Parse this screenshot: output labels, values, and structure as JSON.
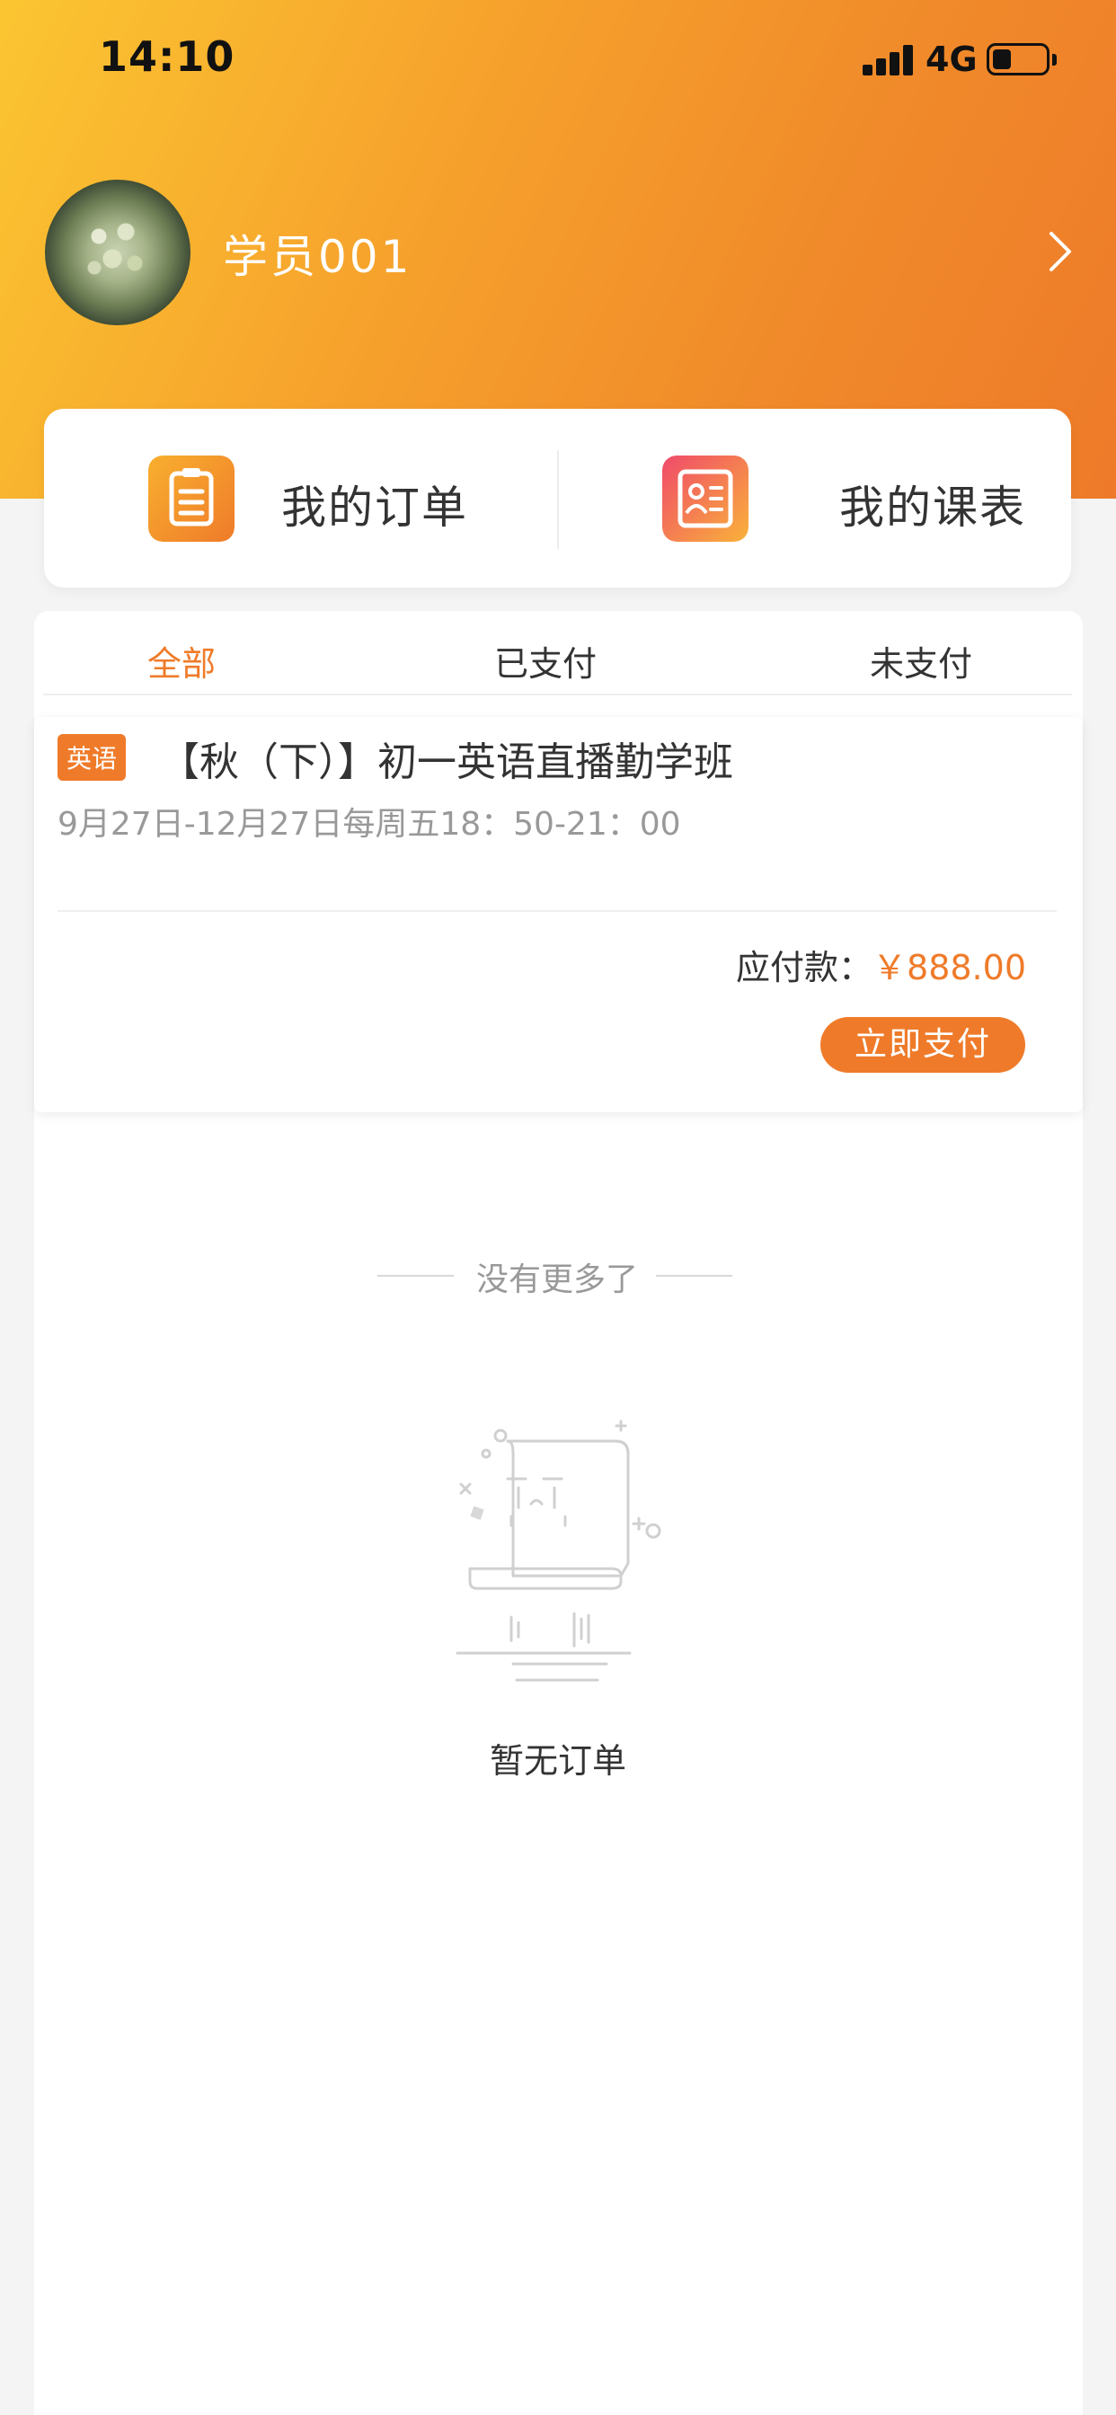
{
  "status_bar": {
    "time": "14:10",
    "network": "4G"
  },
  "profile": {
    "username": "学员001",
    "avatar_icon": "avatar-photo",
    "arrow_icon": "chevron-right-icon"
  },
  "quick_links": [
    {
      "label": "我的订单",
      "icon": "clipboard-icon"
    },
    {
      "label": "我的课表",
      "icon": "schedule-icon"
    }
  ],
  "tabs": [
    {
      "label": "全部",
      "active": true
    },
    {
      "label": "已支付",
      "active": false
    },
    {
      "label": "未支付",
      "active": false
    }
  ],
  "orders": [
    {
      "subject": "英语",
      "title": "【秋（下）】初一英语直播勤学班",
      "schedule": "9月27日-12月27日每周五18：50-21：00",
      "amount_label": "应付款：",
      "amount": "￥888.00",
      "pay_label": "立即支付"
    }
  ],
  "list_end_text": "没有更多了",
  "empty_state": {
    "text": "暂无订单",
    "icon": "empty-scroll-icon"
  },
  "colors": {
    "accent": "#ef7b2a",
    "gradient_start": "#fbc531",
    "gradient_end": "#ee7a29"
  }
}
